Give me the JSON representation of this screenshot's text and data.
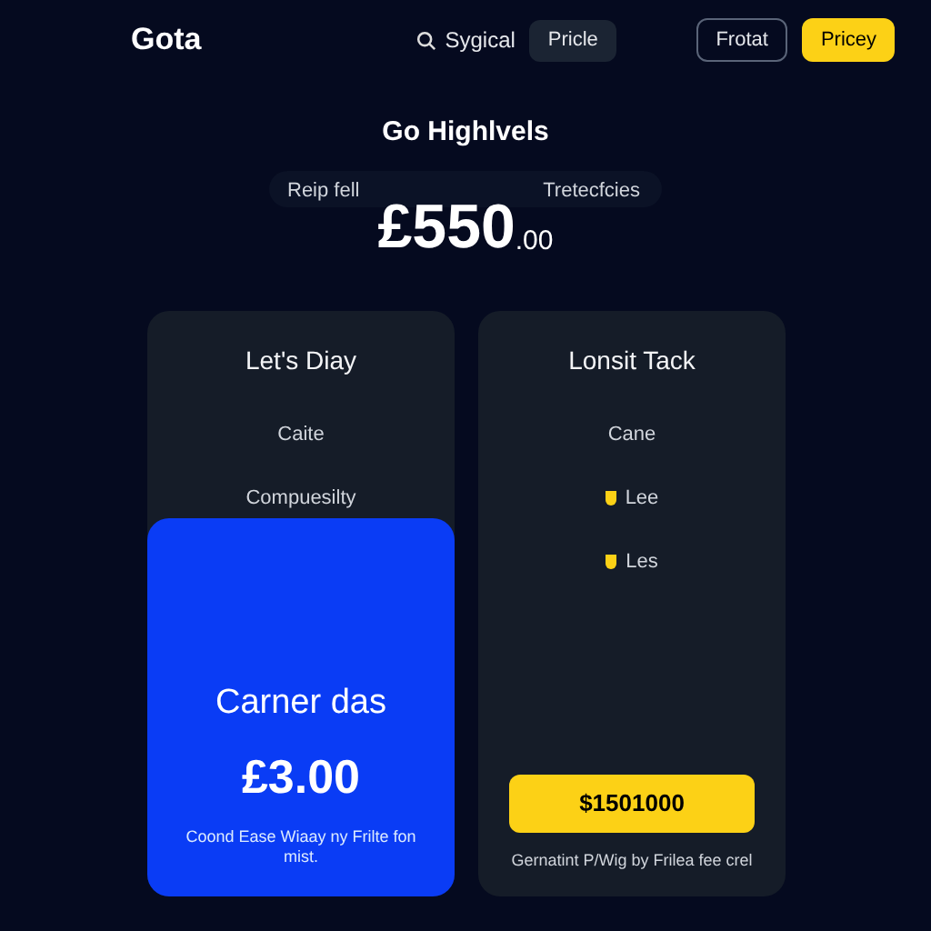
{
  "nav": {
    "logo": "Gota",
    "search": "Sygical",
    "tab": {
      "label": "Pricle",
      "selected": true
    },
    "buttons": [
      {
        "label": "Frotat",
        "kind": "outline"
      },
      {
        "label": "Pricey",
        "kind": "primary"
      }
    ]
  },
  "hero": {
    "title": "Go Highlvels",
    "left_label": "Reip fell",
    "right_label": "Tretecfcies",
    "price": "£550",
    "cents": ".00"
  },
  "plans": [
    {
      "title": "Let's Diay",
      "features": [
        {
          "text": "Caite",
          "bullet": false
        },
        {
          "text": "Compuesilty",
          "bullet": false
        }
      ],
      "overlay": {
        "name": "Carner das",
        "price": "£3.00",
        "note": "Coond Ease Wiaay ny Frilte fon mist."
      }
    },
    {
      "title": "Lonsit Tack",
      "features": [
        {
          "text": "Cane",
          "bullet": false
        },
        {
          "text": "Lee",
          "bullet": true
        },
        {
          "text": "Les",
          "bullet": true
        }
      ],
      "button": "$1501000",
      "note": "Gernatint P/Wig by Frilea fee crel"
    }
  ]
}
